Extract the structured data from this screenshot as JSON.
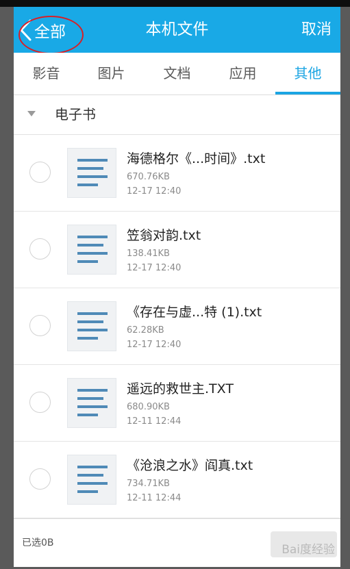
{
  "header": {
    "back_label": "全部",
    "title": "本机文件",
    "cancel_label": "取消"
  },
  "tabs": [
    {
      "label": "影音",
      "active": false
    },
    {
      "label": "图片",
      "active": false
    },
    {
      "label": "文档",
      "active": false
    },
    {
      "label": "应用",
      "active": false
    },
    {
      "label": "其他",
      "active": true
    }
  ],
  "section": {
    "label": "电子书"
  },
  "files": [
    {
      "name": "海德格尔《...时间》.txt",
      "size": "670.76KB",
      "date": "12-17 12:40"
    },
    {
      "name": "笠翁对韵.txt",
      "size": "138.41KB",
      "date": "12-17 12:40"
    },
    {
      "name": "《存在与虚...特 (1).txt",
      "size": "62.28KB",
      "date": "12-17 12:40"
    },
    {
      "name": "遥远的救世主.TXT",
      "size": "680.90KB",
      "date": "12-11 12:44"
    },
    {
      "name": "《沧浪之水》阎真.txt",
      "size": "734.71KB",
      "date": "12-11 12:44"
    }
  ],
  "footer": {
    "selected_label": "已选0B",
    "watermark": "Bai度经验"
  },
  "colors": {
    "titlebar": "#19a9e6",
    "accent": "#1ba5e3",
    "annotation_circle": "#d81f26",
    "doc_lines": "#4f8ab7"
  },
  "icons": {
    "back": "chevron-left-icon",
    "file": "text-document-icon",
    "section": "triangle-down-icon"
  }
}
